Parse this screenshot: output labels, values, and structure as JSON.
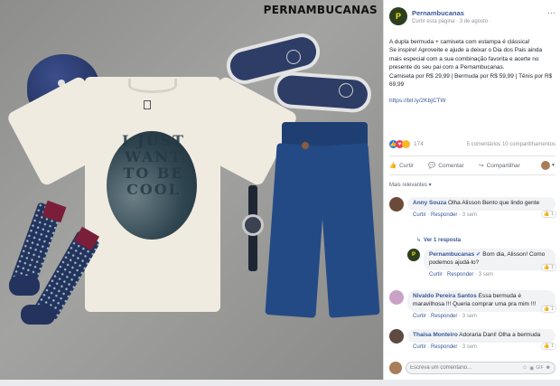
{
  "photo": {
    "brand_text": "PERNAMBUCANAS",
    "tshirt_print": "I JUST WANT TO BE COOL"
  },
  "post": {
    "page_name": "Pernambucanas",
    "meta": "Curtir esta página · 3 de agosto ·",
    "more": "···",
    "body_line1": "A dupla bermuda + camiseta com estampa é clássica!",
    "body_line2": "Se inspire! Aproveite e ajude a deixar o Dia dos Pais ainda mais especial com a sua combinação favorita e acerte no presente do seu pai com a Pernambucanas.",
    "prices": "Camiseta por R$ 29,99 | Bermuda por R$ 59,99 | Tênis por R$ 69,99",
    "link": "https://bit.ly/2KbjCTW",
    "reactions_count": "174",
    "counts": "5 comentários   10 compartilhamentos",
    "actions": {
      "like": "Curtir",
      "comment": "Comentar",
      "share": "Compartilhar"
    },
    "sort": "Mais relevantes ▾"
  },
  "comments": [
    {
      "name": "Anny Souza",
      "text": "Olha Alisson Bento que lindo gente",
      "actions": [
        "Curtir",
        "Responder",
        "3 sem"
      ],
      "reacts": "1"
    },
    {
      "replies_link": "Ver 1 resposta"
    },
    {
      "name": "Pernambucanas",
      "text": "Bom dia, Alisson! Como podemos ajudá-lo?",
      "actions": [
        "Curtir",
        "Responder",
        "3 sem"
      ],
      "reacts": "1"
    },
    {
      "name": "Nivaldo Pereira Santos",
      "text": "Essa bermuda é maravilhosa !!! Queria comprar uma pra mim !!!",
      "actions": [
        "Curtir",
        "Responder",
        "3 sem"
      ],
      "reacts": "1"
    },
    {
      "name": "Thaisa Monteiro",
      "text": "Adoraria Dani! Olha a bermuda",
      "actions": [
        "Curtir",
        "Responder",
        "3 sem"
      ],
      "reacts": "1"
    }
  ],
  "composer": {
    "placeholder": "Escreva um comentário..."
  },
  "colors": {
    "panel_bg": "#ffffff",
    "link": "#385898",
    "like": "#1877f2",
    "love": "#f33e58"
  }
}
